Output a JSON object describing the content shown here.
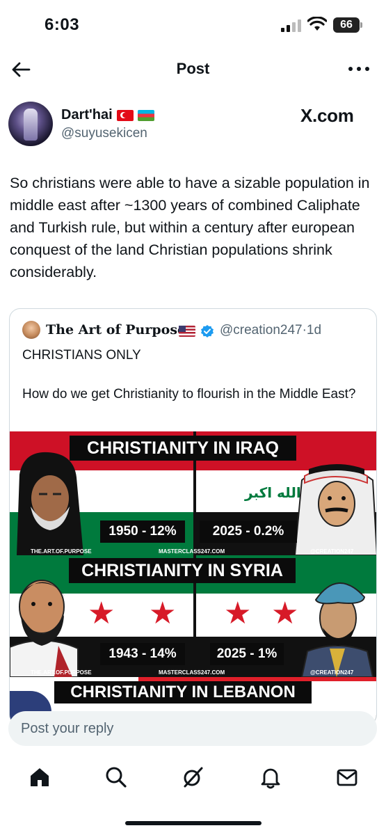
{
  "status_bar": {
    "time": "6:03",
    "battery": "66"
  },
  "header": {
    "title": "Post"
  },
  "author": {
    "name": "Dart'hai",
    "handle": "@suyusekicen",
    "flags": [
      "turkey-flag",
      "azerbaijan-flag"
    ]
  },
  "xcom_label": "X.com",
  "post": {
    "text": "So christians were able to have a sizable population in middle east after ~1300 years of combined Caliphate and Turkish rule, but within a century after european conquest of the land Christian populations shrink considerably."
  },
  "quote": {
    "name": "The Art of Purpose",
    "handle": "@creation247",
    "time": "1d",
    "line1": "CHRISTIANS ONLY",
    "line2": "How do we get Christianity to flourish in the Middle East?",
    "infographic": {
      "sections": [
        {
          "title": "CHRISTIANITY IN IRAQ",
          "left_label": "1950 - 12%",
          "right_label": "2025 - 0.2%",
          "left_credit": "THE.ART.OF.PURPOSE",
          "center_credit": "MASTERCLASS247.COM",
          "right_credit": "@CREATION247",
          "flag_text": "الله اكبر"
        },
        {
          "title": "CHRISTIANITY IN SYRIA",
          "left_label": "1943 - 14%",
          "right_label": "2025 - 1%",
          "left_credit": "THE.ART.OF.PURPOSE",
          "center_credit": "MASTERCLASS247.COM",
          "right_credit": "@CREATION247"
        },
        {
          "title": "CHRISTIANITY IN LEBANON"
        }
      ]
    }
  },
  "reply": {
    "placeholder": "Post your reply"
  },
  "nav": [
    "home-icon",
    "search-icon",
    "grok-icon",
    "notifications-icon",
    "messages-icon"
  ],
  "colors": {
    "text": "#0f1419",
    "muted": "#536471",
    "border": "#cfd9de",
    "flag_red": "#ce1126",
    "flag_green": "#007a3d",
    "verified_blue": "#1d9bf0"
  }
}
